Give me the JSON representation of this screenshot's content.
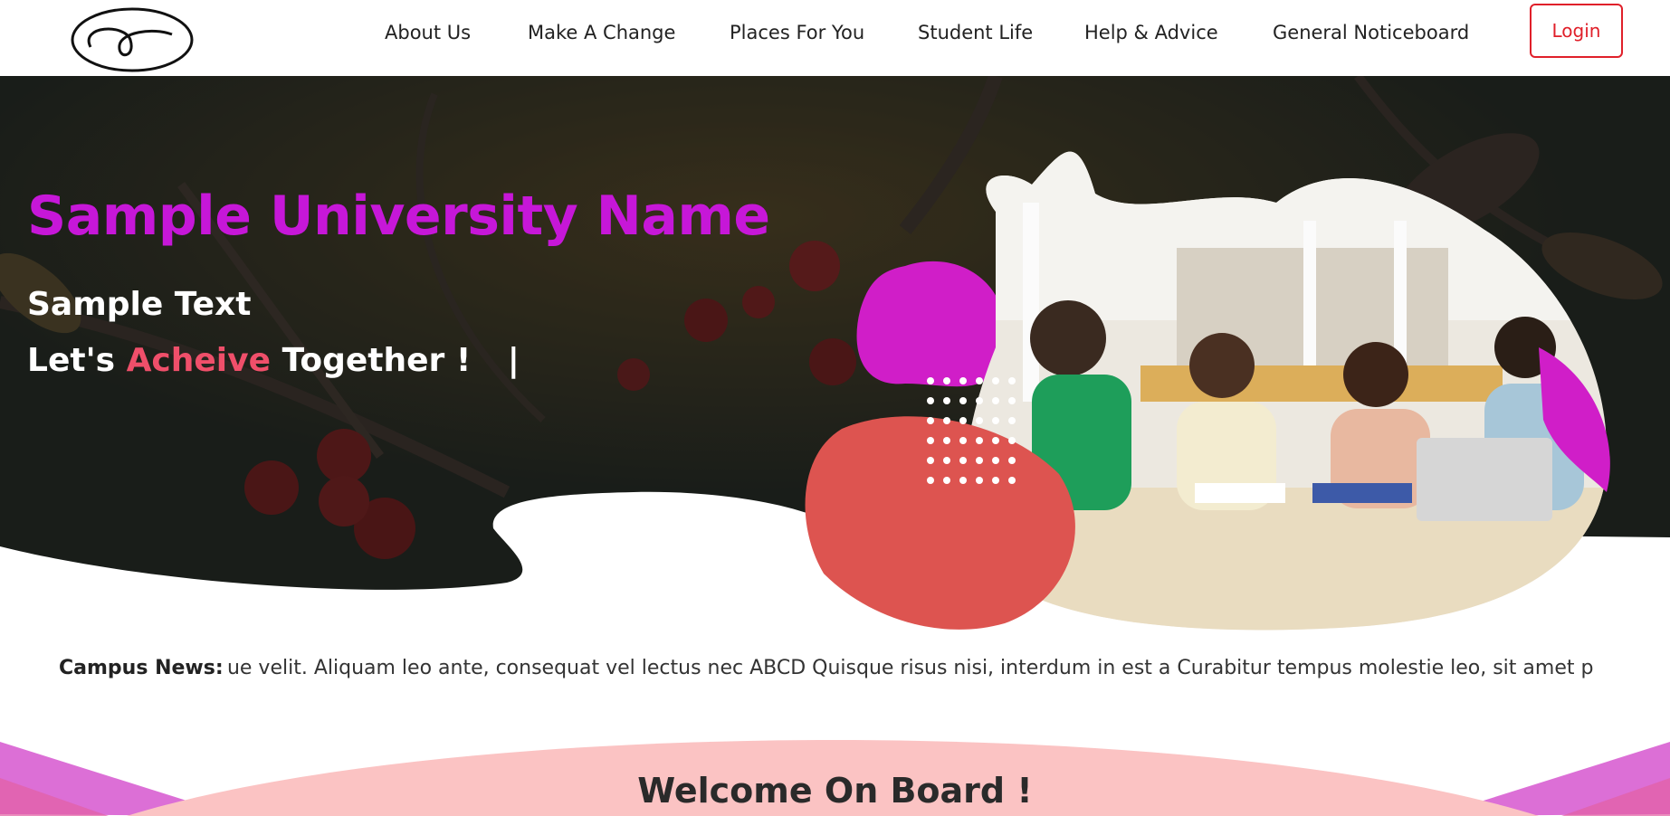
{
  "nav": {
    "items": [
      {
        "label": "About Us"
      },
      {
        "label": "Make A Change"
      },
      {
        "label": "Places For You"
      },
      {
        "label": "Student Life"
      },
      {
        "label": "Help & Advice"
      },
      {
        "label": "General Noticeboard"
      }
    ],
    "login_label": "Login",
    "logo_icon": "loop-logo-icon"
  },
  "hero": {
    "title": "Sample University Name",
    "subtitle": "Sample Text",
    "tagline_start": "Let's",
    "tagline_accent": "Acheive",
    "tagline_end": "Together !",
    "cursor": "|",
    "image": "students-studying-photo",
    "colors": {
      "title": "#c617d8",
      "accent": "#ef4f6a",
      "blob_magenta": "#d01ec8",
      "blob_coral": "#dd5450"
    }
  },
  "news": {
    "label": "Campus News:",
    "text": "que velit. Aliquam leo ante, consequat vel lectus nec ABCD Quisque risus nisi, interdum in est a Curabitur tempus molestie leo, sit amet p"
  },
  "welcome": {
    "title": "Welcome On Board !"
  },
  "colors": {
    "login_border": "#e0202a",
    "welcome_bg": "#fbc3c3",
    "welcome_side": "#dc6fd6"
  }
}
